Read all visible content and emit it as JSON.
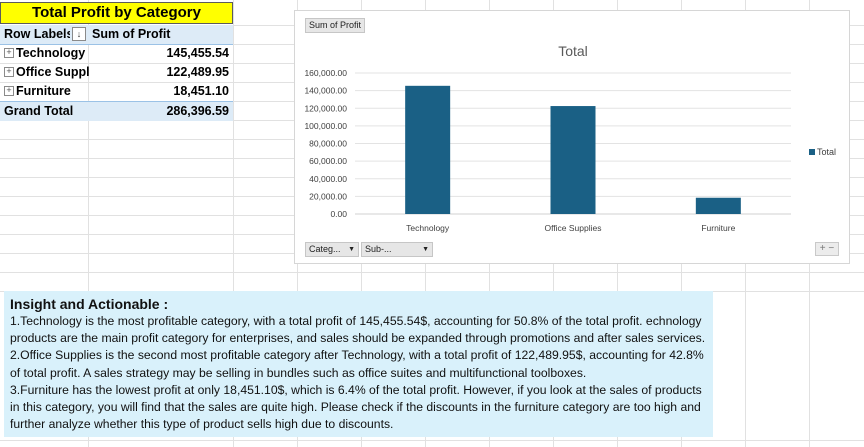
{
  "pivot": {
    "title": "Total Profit by Category",
    "row_labels_header": "Row Labels",
    "sum_header": "Sum of Profit",
    "rows": [
      {
        "label": "Technology",
        "value": "145,455.54"
      },
      {
        "label": "Office Suppli",
        "value": "122,489.95"
      },
      {
        "label": "Furniture",
        "value": "18,451.10"
      }
    ],
    "grand_total_label": "Grand Total",
    "grand_total_value": "286,396.59"
  },
  "chart": {
    "field_button_value": "Sum of Profit",
    "axis_buttons": [
      "Categ...",
      "Sub-..."
    ],
    "legend_label": "Total",
    "bar_color": "#1a6085",
    "plus_minus": "+ −"
  },
  "chart_data": {
    "type": "bar",
    "title": "Total",
    "categories": [
      "Technology",
      "Office Supplies",
      "Furniture"
    ],
    "series": [
      {
        "name": "Total",
        "values": [
          145455.54,
          122489.95,
          18451.1
        ]
      }
    ],
    "ylim": [
      0,
      160000
    ],
    "yticks": [
      "0.00",
      "20,000.00",
      "40,000.00",
      "60,000.00",
      "80,000.00",
      "100,000.00",
      "120,000.00",
      "140,000.00",
      "160,000.00"
    ],
    "ytick_values": [
      0,
      20000,
      40000,
      60000,
      80000,
      100000,
      120000,
      140000,
      160000
    ],
    "grid": true,
    "legend": "right"
  },
  "insight": {
    "heading": "Insight and Actionable :",
    "points": [
      "1.Technology is the most profitable category, with a total profit of 145,455.54$, accounting for 50.8% of the total profit. echnology products are the main profit category for enterprises, and sales should be expanded through promotions and after sales services.",
      "2.Office Supplies is the second most profitable category after Technology, with a total profit of 122,489.95$, accounting for 42.8% of total profit. A sales strategy may be selling in bundles such as office suites and multifunctional toolboxes.",
      "3.Furniture has the lowest profit at only 18,451.10$, which is 6.4% of the total profit. However, if you look at the sales of products in this category, you will find that the sales are quite high. Please check if the discounts in the furniture category are too high and further analyze whether this type of product sells high due to discounts."
    ]
  }
}
